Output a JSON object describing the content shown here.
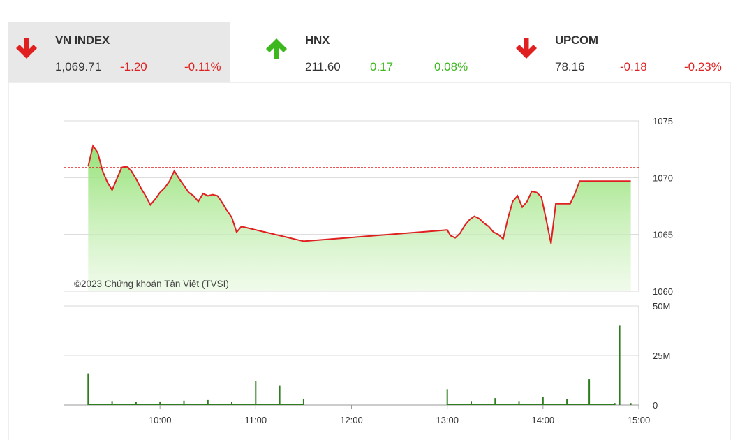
{
  "indices": [
    {
      "name": "VN INDEX",
      "value": "1,069.71",
      "change": "-1.20",
      "percent": "-0.11%",
      "direction": "down",
      "active": true
    },
    {
      "name": "HNX",
      "value": "211.60",
      "change": "0.17",
      "percent": "0.08%",
      "direction": "up",
      "active": false
    },
    {
      "name": "UPCOM",
      "value": "78.16",
      "change": "-0.18",
      "percent": "-0.23%",
      "direction": "down",
      "active": false
    }
  ],
  "colors": {
    "up": "#3cb81e",
    "down": "#e02020",
    "line": "#e02020",
    "area": "#8fe070",
    "volume": "#2e7d1e",
    "reference": "#e02020"
  },
  "chart_data": {
    "type": "line",
    "watermark": "©2023 Chứng khoán Tân Việt (TVSI)",
    "reference_value": 1070.9,
    "price_axis": {
      "min": 1060,
      "max": 1075,
      "ticks": [
        1075,
        1070,
        1065,
        1060
      ],
      "position": "right"
    },
    "volume_axis": {
      "min": 0,
      "max": 50,
      "ticks": [
        50,
        25,
        0
      ],
      "tick_labels": [
        "50M",
        "25M",
        "0"
      ],
      "unit": "M"
    },
    "time_ticks": [
      "10:00",
      "11:00",
      "12:00",
      "13:00",
      "14:00",
      "15:00"
    ],
    "series": [
      {
        "kind": "price",
        "x": [
          "09:15",
          "09:18",
          "09:21",
          "09:24",
          "09:27",
          "09:30",
          "09:33",
          "09:36",
          "09:39",
          "09:42",
          "09:45",
          "09:48",
          "09:51",
          "09:54",
          "09:57",
          "10:00",
          "10:03",
          "10:06",
          "10:09",
          "10:12",
          "10:15",
          "10:18",
          "10:21",
          "10:24",
          "10:27",
          "10:30",
          "10:33",
          "10:36",
          "10:39",
          "10:42",
          "10:45",
          "10:48",
          "10:51",
          "10:54",
          "10:57",
          "11:00",
          "11:03",
          "11:06",
          "11:09",
          "11:12",
          "11:15",
          "11:18",
          "11:21",
          "11:24",
          "11:27",
          "11:30",
          "13:00",
          "13:02",
          "13:05",
          "13:08",
          "13:11",
          "13:14",
          "13:17",
          "13:20",
          "13:23",
          "13:26",
          "13:29",
          "13:32",
          "13:35",
          "13:38",
          "13:41",
          "13:44",
          "13:47",
          "13:50",
          "13:53",
          "13:56",
          "13:59",
          "14:02",
          "14:05",
          "14:08",
          "14:11",
          "14:14",
          "14:17",
          "14:20",
          "14:23",
          "14:25",
          "14:27",
          "14:28",
          "14:29",
          "14:30",
          "14:35",
          "14:40",
          "14:45",
          "14:50",
          "14:55"
        ],
        "values": [
          1071.0,
          1072.8,
          1072.2,
          1070.6,
          1069.6,
          1068.9,
          1069.9,
          1070.9,
          1071.0,
          1070.6,
          1069.9,
          1069.1,
          1068.4,
          1067.6,
          1068.1,
          1068.7,
          1069.1,
          1069.7,
          1070.6,
          1069.9,
          1069.3,
          1068.7,
          1068.4,
          1067.9,
          1068.6,
          1068.4,
          1068.5,
          1068.4,
          1067.8,
          1067.1,
          1066.5,
          1065.2,
          1065.7,
          1065.6,
          1065.5,
          1065.4,
          1065.3,
          1065.2,
          1065.1,
          1065.0,
          1064.9,
          1064.8,
          1064.7,
          1064.6,
          1064.5,
          1064.4,
          1065.4,
          1064.9,
          1064.7,
          1065.1,
          1065.8,
          1066.3,
          1066.6,
          1066.4,
          1066.0,
          1065.7,
          1065.2,
          1065.0,
          1064.6,
          1066.4,
          1067.9,
          1068.4,
          1067.4,
          1067.9,
          1068.8,
          1068.7,
          1068.3,
          1066.3,
          1064.2,
          1067.7,
          1067.7,
          1067.7,
          1067.7,
          1068.6,
          1069.7,
          1069.7,
          1069.7,
          1069.7,
          1069.7,
          1069.7,
          1069.7,
          1069.7,
          1069.7,
          1069.7,
          1069.7
        ],
        "name": ""
      },
      {
        "kind": "volume",
        "x": [
          "09:15",
          "09:30",
          "09:45",
          "10:00",
          "10:15",
          "10:30",
          "10:45",
          "11:00",
          "11:15",
          "11:30",
          "13:00",
          "13:15",
          "13:30",
          "13:45",
          "14:00",
          "14:15",
          "14:29",
          "14:45",
          "14:48",
          "14:55"
        ],
        "values": [
          16,
          2,
          1.5,
          1.8,
          2.2,
          2.5,
          1.5,
          12,
          10,
          3,
          8,
          2,
          3.5,
          2,
          4,
          3,
          13,
          1,
          40,
          1
        ],
        "name": ""
      }
    ]
  }
}
